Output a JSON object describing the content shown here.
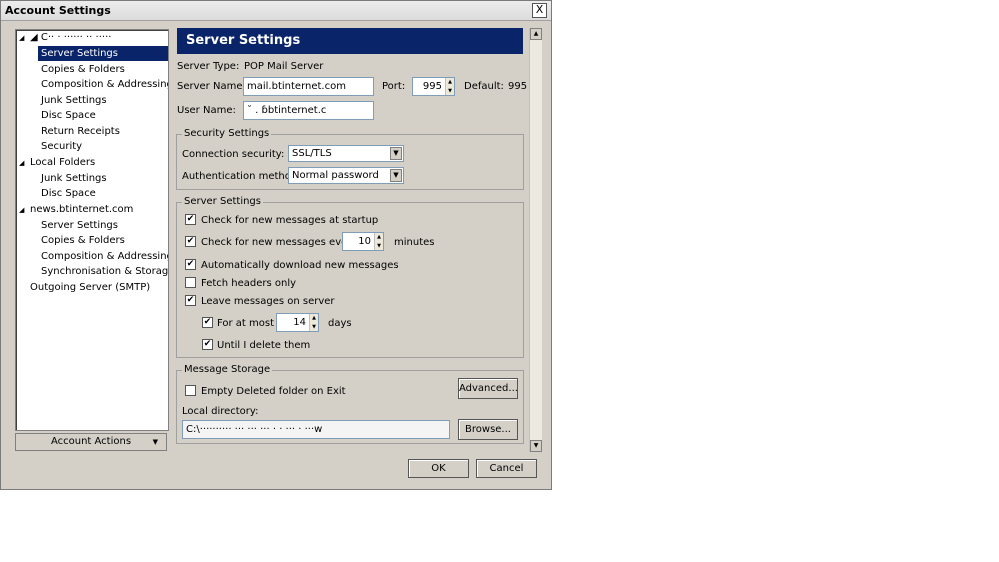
{
  "window": {
    "title": "Account Settings",
    "close_label": "X"
  },
  "tree": {
    "items": [
      {
        "label": "◢  C·· ·  ······  ·· ·····",
        "level": 0
      },
      {
        "label": "Server Settings",
        "level": 1,
        "selected": true
      },
      {
        "label": "Copies & Folders",
        "level": 1
      },
      {
        "label": "Composition & Addressing",
        "level": 1
      },
      {
        "label": "Junk Settings",
        "level": 1
      },
      {
        "label": "Disc Space",
        "level": 1
      },
      {
        "label": "Return Receipts",
        "level": 1
      },
      {
        "label": "Security",
        "level": 1
      },
      {
        "label": "Local Folders",
        "level": 0
      },
      {
        "label": "Junk Settings",
        "level": 1
      },
      {
        "label": "Disc Space",
        "level": 1
      },
      {
        "label": "news.btinternet.com",
        "level": 0
      },
      {
        "label": "Server Settings",
        "level": 1
      },
      {
        "label": "Copies & Folders",
        "level": 1
      },
      {
        "label": "Composition & Addressing",
        "level": 1
      },
      {
        "label": "Synchronisation & Storage",
        "level": 1
      },
      {
        "label": "Outgoing Server (SMTP)",
        "level": 0
      }
    ],
    "account_actions": "Account Actions"
  },
  "header": {
    "title": "Server Settings"
  },
  "server": {
    "type_label": "Server Type:",
    "type_value": "POP Mail Server",
    "name_label": "Server Name:",
    "name_value": "mail.btinternet.com",
    "port_label": "Port:",
    "port_value": "995",
    "default_label": "Default:",
    "default_value": "995",
    "user_label": "User Name:",
    "user_value": "˘          .      ɓbtinternet.c"
  },
  "security": {
    "legend": "Security Settings",
    "connection_label": "Connection security:",
    "connection_value": "SSL/TLS",
    "auth_label": "Authentication method:",
    "auth_value": "Normal password"
  },
  "server_settings": {
    "legend": "Server Settings",
    "check_startup": "Check for new messages at startup",
    "check_every": "Check for new messages every",
    "check_every_value": "10",
    "minutes": "minutes",
    "auto_download": "Automatically download new messages",
    "fetch_headers": "Fetch headers only",
    "leave_on_server": "Leave messages on server",
    "for_at_most": "For at most",
    "days_value": "14",
    "days": "days",
    "until_delete": "Until I delete them"
  },
  "storage": {
    "legend": "Message Storage",
    "empty_deleted": "Empty Deleted folder on Exit",
    "advanced": "Advanced...",
    "local_dir_label": "Local directory:",
    "local_dir_value": "C:\\··········  ···  ···  ··· ·  ·   ··· ·  ···w",
    "browse": "Browse..."
  },
  "footer": {
    "ok": "OK",
    "cancel": "Cancel"
  },
  "checkbox": {
    "check": "✔"
  }
}
